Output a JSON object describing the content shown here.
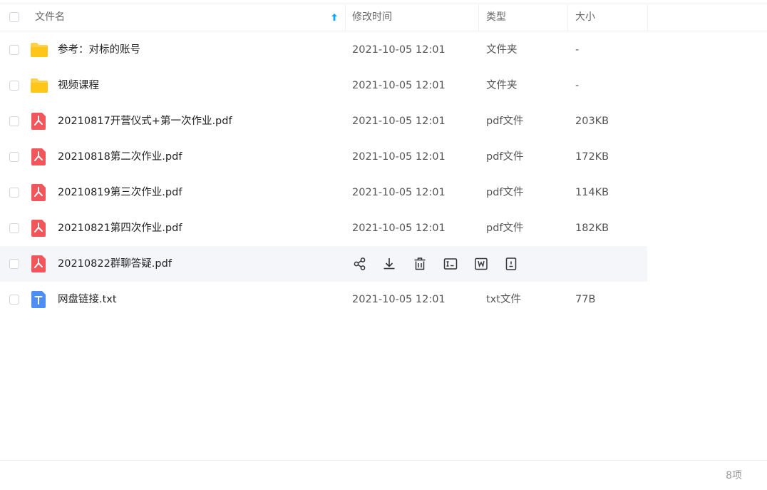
{
  "columns": {
    "name": "文件名",
    "modified": "修改时间",
    "type": "类型",
    "size": "大小"
  },
  "sort": {
    "column": "name",
    "direction": "ascending"
  },
  "files": [
    {
      "name": "参考：对标的账号",
      "modified": "2021-10-05 12:01",
      "type": "文件夹",
      "size": "-",
      "icon": "folder-icon"
    },
    {
      "name": "视频课程",
      "modified": "2021-10-05 12:01",
      "type": "文件夹",
      "size": "-",
      "icon": "folder-icon"
    },
    {
      "name": "20210817开营仪式+第一次作业.pdf",
      "modified": "2021-10-05 12:01",
      "type": "pdf文件",
      "size": "203KB",
      "icon": "pdf-icon"
    },
    {
      "name": "20210818第二次作业.pdf",
      "modified": "2021-10-05 12:01",
      "type": "pdf文件",
      "size": "172KB",
      "icon": "pdf-icon"
    },
    {
      "name": "20210819第三次作业.pdf",
      "modified": "2021-10-05 12:01",
      "type": "pdf文件",
      "size": "114KB",
      "icon": "pdf-icon"
    },
    {
      "name": "20210821第四次作业.pdf",
      "modified": "2021-10-05 12:01",
      "type": "pdf文件",
      "size": "182KB",
      "icon": "pdf-icon"
    },
    {
      "name": "20210822群聊答疑.pdf",
      "modified": "",
      "type": "",
      "size": "",
      "icon": "pdf-icon",
      "hovered": true,
      "actions": [
        "share-icon",
        "download-icon",
        "delete-icon",
        "rename-icon",
        "copy-icon",
        "more-icon"
      ]
    },
    {
      "name": "网盘链接.txt",
      "modified": "2021-10-05 12:01",
      "type": "txt文件",
      "size": "77B",
      "icon": "txt-icon"
    }
  ],
  "footer": {
    "count": "8项"
  },
  "colors": {
    "folder": "#FFD04B",
    "pdf": "#F2555A",
    "txt": "#4C8DF6",
    "accent": "#06A7FF"
  }
}
